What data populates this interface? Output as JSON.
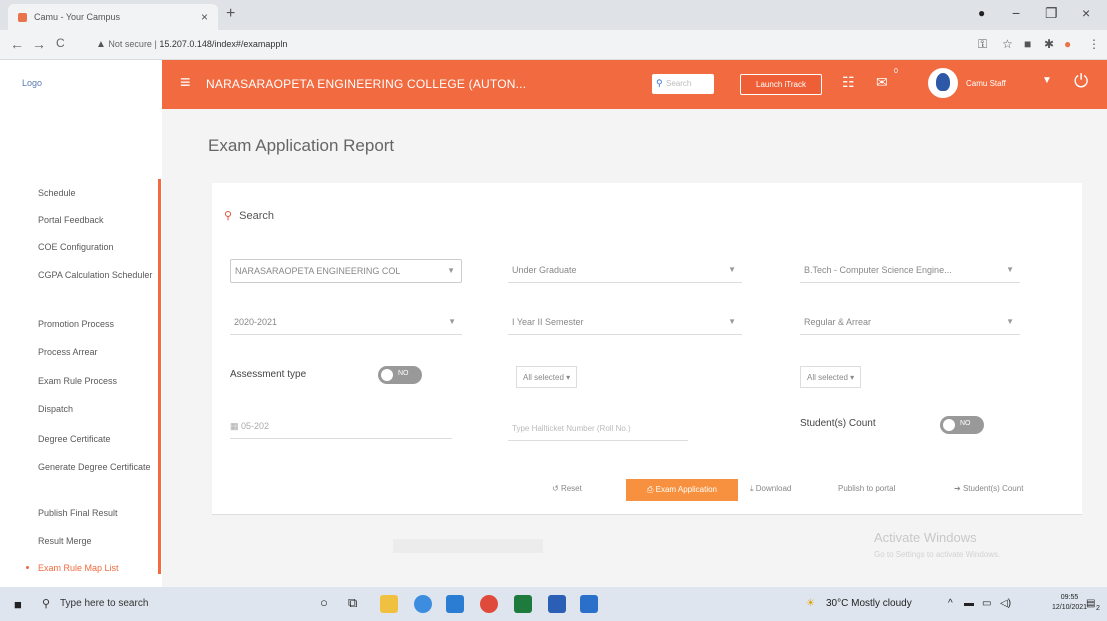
{
  "browser": {
    "tab_title": "Camu - Your Campus",
    "tab_close": "×",
    "new_tab": "+",
    "window_controls": [
      "−",
      "❐",
      "×"
    ],
    "nav": [
      "←",
      "→",
      "C"
    ],
    "not_secure": "Not secure",
    "url": "15.207.0.148/index#/examappln"
  },
  "header": {
    "logo_alt": "Logo",
    "college_name": "NARASARAOPETA ENGINEERING COLLEGE (AUTON...",
    "search_placeholder": "Search",
    "launch_button": "Launch iTrack",
    "user_name": "Camu Staff"
  },
  "sidebar": {
    "items": [
      {
        "label": "Schedule"
      },
      {
        "label": "Portal Feedback"
      },
      {
        "label": "COE Configuration"
      },
      {
        "label": "CGPA Calculation Scheduler"
      },
      {
        "label": "Promotion Process"
      },
      {
        "label": "Process Arrear"
      },
      {
        "label": "Exam Rule Process"
      },
      {
        "label": "Dispatch"
      },
      {
        "label": "Degree Certificate"
      },
      {
        "label": "Generate Degree Certificate"
      },
      {
        "label": "Publish Final Result"
      },
      {
        "label": "Result Merge"
      },
      {
        "label": "Exam Rule Map List",
        "active": true
      }
    ]
  },
  "main": {
    "title": "Exam Application Report",
    "search_header": "Search",
    "filters": {
      "institution": "NARASARAOPETA ENGINEERING COL",
      "program_level": "Under Graduate",
      "program": "B.Tech - Computer Science Engine...",
      "academic_year": "2020-2021",
      "semester": "I Year II Semester",
      "exam_type": "Regular & Arrear",
      "assessment_label": "Assessment type",
      "assessment_toggle": "NO",
      "multiselect_1": "All selected ▾",
      "multiselect_2": "All selected ▾",
      "date_value": "05-202",
      "hall_ticket_placeholder": "Type Hallticket Number (Roll No.)",
      "student_count_label": "Student(s) Count",
      "student_count_toggle": "NO"
    },
    "actions": {
      "reset": "Reset",
      "exam_application": "Exam Application",
      "download": "Download",
      "publish": "Publish to portal",
      "student_count": "Student(s) Count"
    },
    "watermark_title": "Activate Windows",
    "watermark_sub": "Go to Settings to activate Windows."
  },
  "taskbar": {
    "search_text": "Type here to search",
    "weather": "30°C  Mostly cloudy",
    "time": "09:55",
    "date": "12/10/2021",
    "notification_count": "2"
  },
  "colors": {
    "accent": "#f26a3f",
    "button_orange": "#f7913f"
  }
}
